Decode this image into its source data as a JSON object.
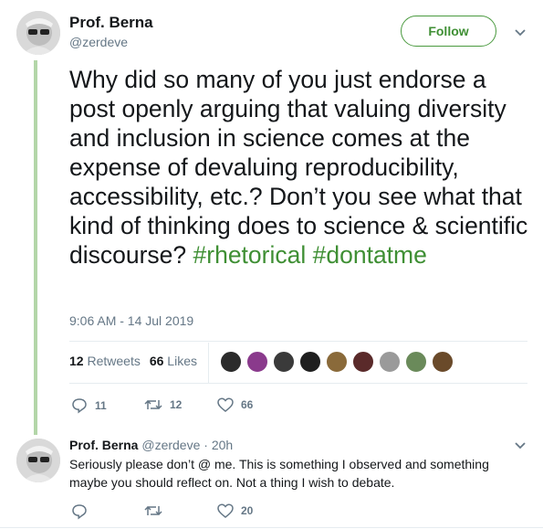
{
  "tweet": {
    "author_name": "Prof. Berna",
    "author_handle": "@zerdeve",
    "follow_label": "Follow",
    "text": "Why did so many of you just endorse a post openly arguing that valuing diversity and inclusion in science comes at the expense of devaluing reproducibility, accessibility, etc.? Don’t you see what that kind of thinking does to science & scientific discourse? ",
    "hashtags": [
      "#rhetorical",
      "#dontatme"
    ],
    "timestamp": "9:06 AM - 14 Jul 2019",
    "retweets_count": "12",
    "retweets_label": "Retweets",
    "likes_count": "66",
    "likes_label": "Likes",
    "liker_avatar_colors": [
      "#2b2b2b",
      "#8a3a8c",
      "#3a3a3a",
      "#1f1f1f",
      "#8a6a3a",
      "#5a2a2a",
      "#9a9a9a",
      "#6a8a5a",
      "#6a4a2a"
    ],
    "actions": {
      "replies": "11",
      "retweets": "12",
      "likes": "66"
    }
  },
  "reply": {
    "author_name": "Prof. Berna",
    "author_handle": "@zerdeve",
    "time": "· 20h",
    "text": "Seriously please don’t @ me. This is something I observed and something maybe you should reflect on. Not a thing I wish to debate.",
    "actions": {
      "replies": "",
      "retweets": "",
      "likes": "20"
    }
  },
  "colors": {
    "accent": "#3f8f34",
    "thread_line": "#b3d6a8",
    "muted": "#657786"
  }
}
